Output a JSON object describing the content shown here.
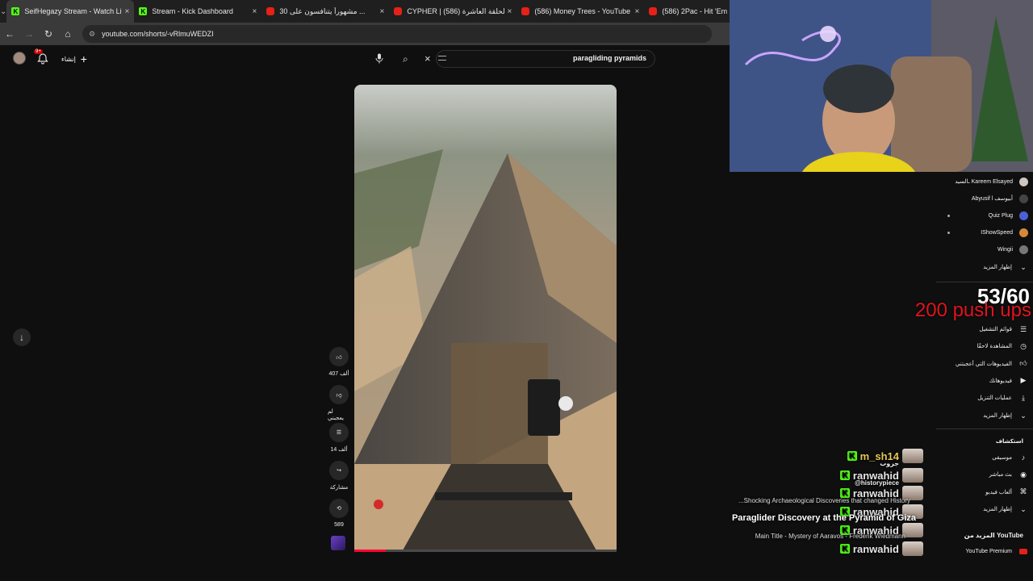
{
  "browser": {
    "tabs": [
      {
        "title": "SeifHegazy Stream - Watch Live",
        "favicon": "kick-icon",
        "active": true
      },
      {
        "title": "Stream - Kick Dashboard",
        "favicon": "kick-icon",
        "active": false
      },
      {
        "title": "30 مشهوراً يتنافسون على ...",
        "favicon": "youtube-icon",
        "active": false
      },
      {
        "title": "CYPHER | الحلقة العاشرة (586)",
        "favicon": "youtube-icon",
        "active": false
      },
      {
        "title": "(586) Money Trees - YouTube",
        "favicon": "youtube-icon",
        "active": false
      },
      {
        "title": "(586) 2Pac - Hit 'Em",
        "favicon": "youtube-icon",
        "active": false
      }
    ],
    "url": "youtube.com/shorts/-vRlmuWEDZI"
  },
  "youtube": {
    "notification_count": "9+",
    "create_label": "إنشاء",
    "search_query": "paragliding pyramids",
    "shorts_actions": {
      "likes": "407 ألف",
      "dislike_label": "لم يعجبني",
      "comments": "14 ألف",
      "share_label": "مشاركة",
      "remix_count": "589"
    },
    "progress": 0.12,
    "subscriptions": [
      {
        "name": "ـالسيد Kareem Elsayed",
        "avatar_color": "#cfc6bf",
        "dot": false
      },
      {
        "name": "Abyusif l أبيوسف",
        "avatar_color": "#444444",
        "dot": false
      },
      {
        "name": "Quiz Plug",
        "avatar_color": "#4b5fd6",
        "dot": true
      },
      {
        "name": "IShowSpeed",
        "avatar_color": "#d58a3a",
        "dot": true
      },
      {
        "name": "Wingii",
        "avatar_color": "#777777",
        "dot": false
      }
    ],
    "show_more_1": "إظهار المزيد",
    "you_items": [
      {
        "label": "قوائم التشغيل",
        "icon": "playlist-icon"
      },
      {
        "label": "المشاهدة لاحقًا",
        "icon": "clock-icon"
      },
      {
        "label": "الفيديوهات التي أعجبتني",
        "icon": "thumb-up-icon"
      },
      {
        "label": "فيديوهاتك",
        "icon": "play-box-icon"
      },
      {
        "label": "عمليات التنزيل",
        "icon": "download-icon"
      }
    ],
    "show_more_2": "إظهار المزيد",
    "explore_heading": "استكشاف",
    "explore_items": [
      {
        "label": "موسيقى",
        "icon": "music-icon"
      },
      {
        "label": "بث مباشر",
        "icon": "live-icon"
      },
      {
        "label": "ألعاب فيديو",
        "icon": "gamepad-icon"
      }
    ],
    "show_more_3": "إظهار المزيد",
    "more_from_heading": "المزيد من YouTube",
    "premium_label": "YouTube Premium"
  },
  "stream_overlay": {
    "pushup_count": "53/60",
    "pushup_label": "200 push ups",
    "chat": [
      {
        "user": "m_sh14",
        "sub": "جروب",
        "color": "#e6c75a"
      },
      {
        "user": "ranwahid",
        "sub": "@historypiece",
        "color": "#e6e6e6"
      },
      {
        "user": "ranwahid",
        "sub": "",
        "color": "#e6e6e6"
      },
      {
        "user": "ranwahid",
        "sub": "",
        "color": "#e6e6e6"
      },
      {
        "user": "ranwahid",
        "sub": "",
        "color": "#e6e6e6"
      },
      {
        "user": "ranwahid",
        "sub": "",
        "color": "#e6e6e6"
      }
    ],
    "lines": [
      "...Shocking Archaeological Discoveries that changed History",
      "Paraglider Discovery at the Pyramid of Giza",
      "Main Title - Mystery of Aaravos - Frederik Wiedmann"
    ]
  }
}
